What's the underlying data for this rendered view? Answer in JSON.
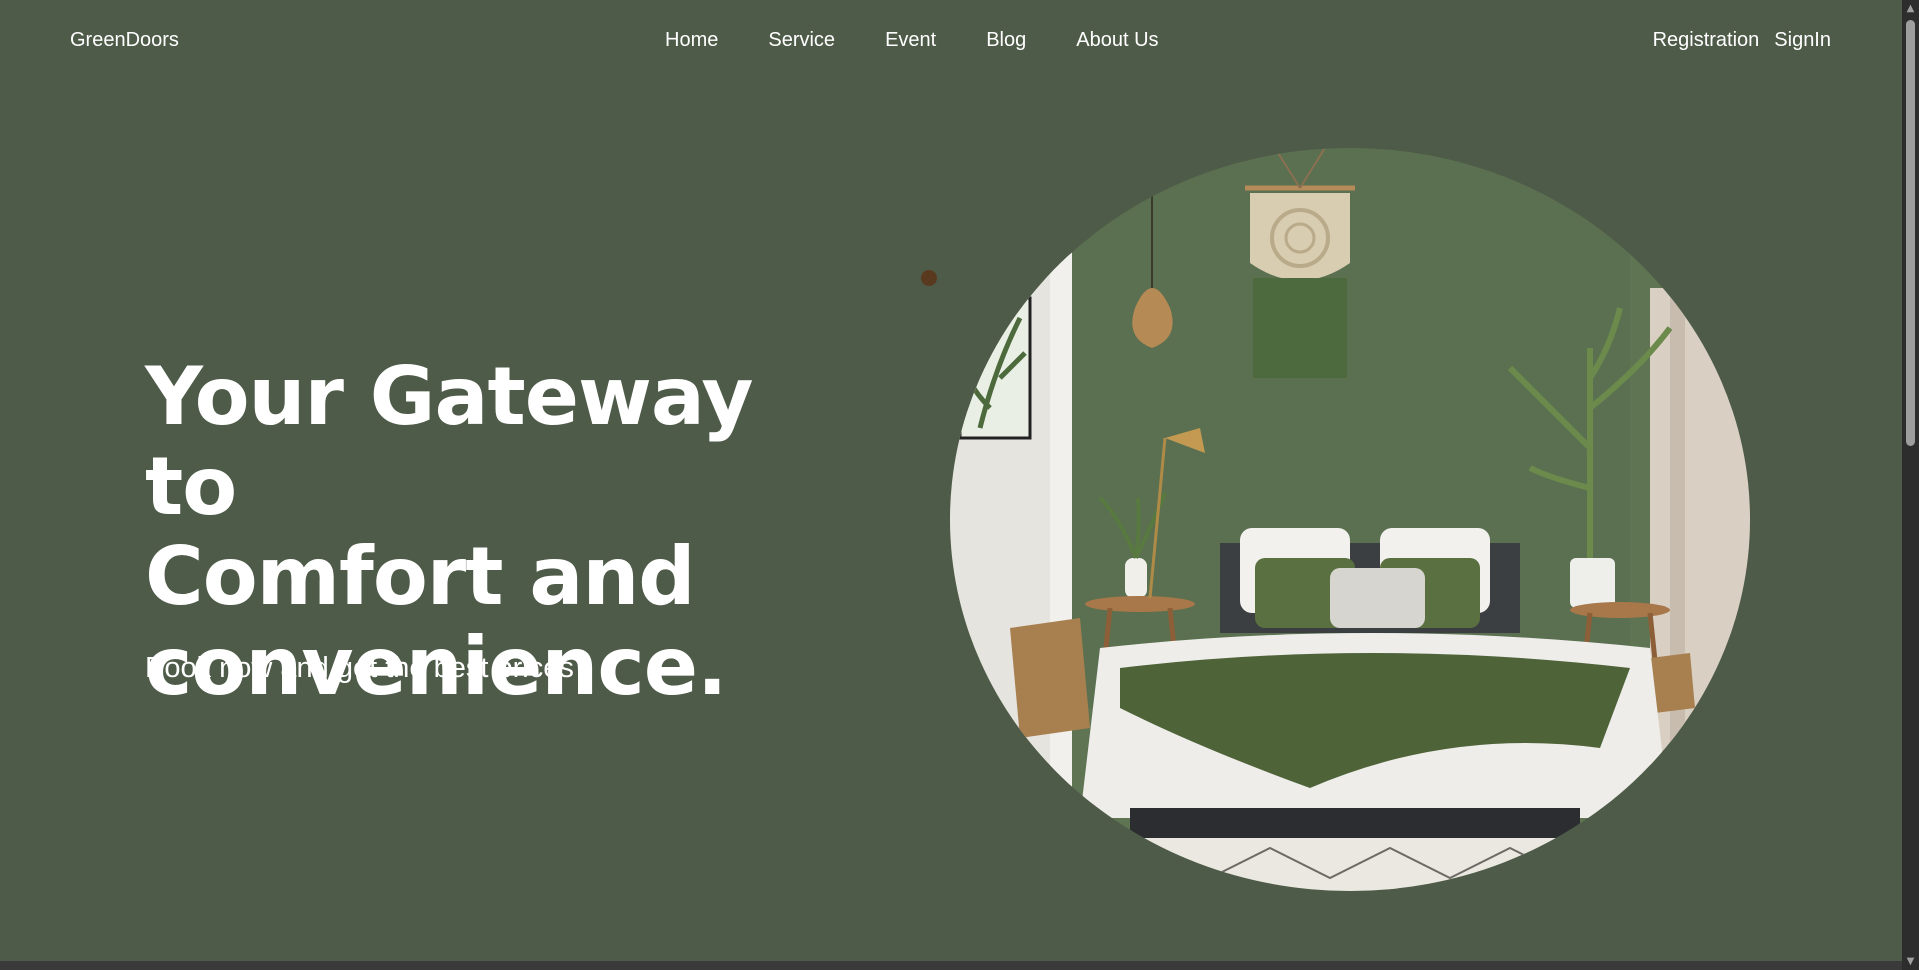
{
  "header": {
    "brand": "GreenDoors",
    "nav": [
      {
        "label": "Home"
      },
      {
        "label": "Service"
      },
      {
        "label": "Event"
      },
      {
        "label": "Blog"
      },
      {
        "label": "About Us"
      }
    ],
    "auth": {
      "registration": "Registration",
      "signin": "SignIn"
    }
  },
  "hero": {
    "title_line1": "Your Gateway to",
    "title_line2": "Comfort and",
    "title_line3": "convenience.",
    "subtitle": "Book now and get the best prices",
    "image_icon": "bedroom-photo"
  },
  "colors": {
    "background": "#4e5b48",
    "text": "#ffffff",
    "accent_dot": "#5a3a1e"
  }
}
